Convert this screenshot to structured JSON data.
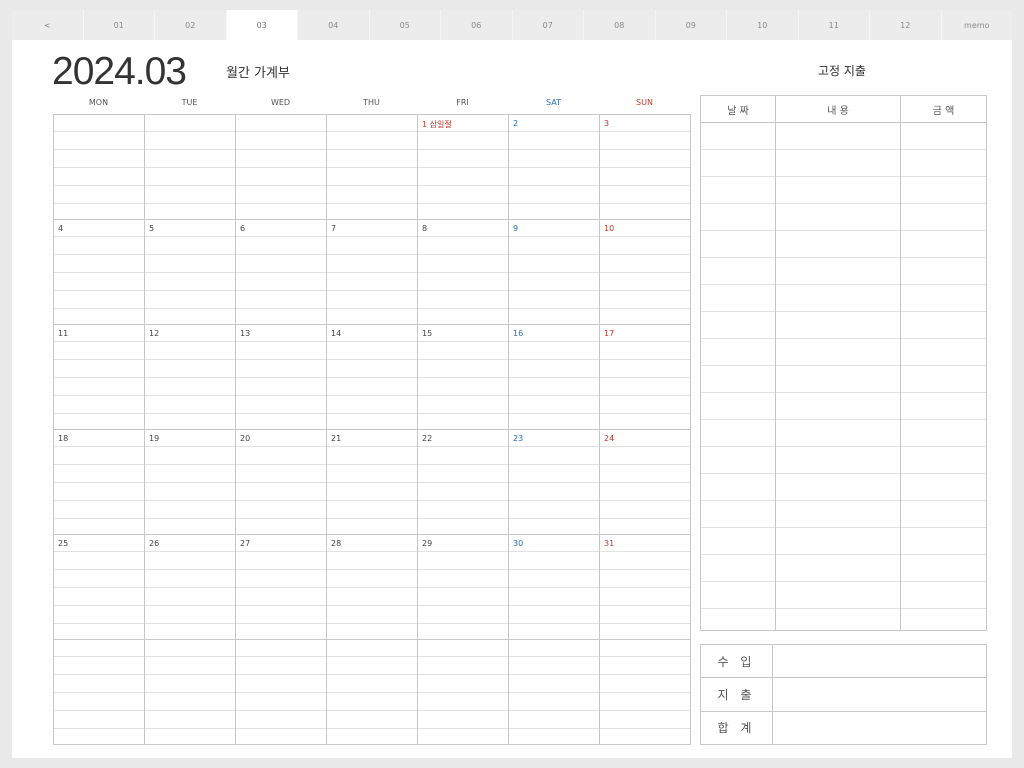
{
  "tabs": [
    {
      "label": "<"
    },
    {
      "label": "01"
    },
    {
      "label": "02"
    },
    {
      "label": "03"
    },
    {
      "label": "04"
    },
    {
      "label": "05"
    },
    {
      "label": "06"
    },
    {
      "label": "07"
    },
    {
      "label": "08"
    },
    {
      "label": "09"
    },
    {
      "label": "10"
    },
    {
      "label": "11"
    },
    {
      "label": "12"
    },
    {
      "label": "memo"
    }
  ],
  "active_tab": "03",
  "header": {
    "year_month": "2024.03",
    "subtitle": "월간 가계부"
  },
  "weekdays": [
    "MON",
    "TUE",
    "WED",
    "THU",
    "FRI",
    "SAT",
    "SUN"
  ],
  "calendar": {
    "weeks": [
      [
        "",
        "",
        "",
        "",
        "1 삼일절",
        "2",
        "3"
      ],
      [
        "4",
        "5",
        "6",
        "7",
        "8",
        "9",
        "10"
      ],
      [
        "11",
        "12",
        "13",
        "14",
        "15",
        "16",
        "17"
      ],
      [
        "18",
        "19",
        "20",
        "21",
        "22",
        "23",
        "24"
      ],
      [
        "25",
        "26",
        "27",
        "28",
        "29",
        "30",
        "31"
      ],
      [
        "",
        "",
        "",
        "",
        "",
        "",
        ""
      ]
    ],
    "holidays": [
      "1 삼일절"
    ]
  },
  "fixed_expense": {
    "title": "고정 지출",
    "headers": [
      "날 짜",
      "내 용",
      "금 액"
    ]
  },
  "summary": {
    "income": "수 입",
    "expense": "지 출",
    "total": "합 계"
  },
  "colors": {
    "saturday": "#2a6fb0",
    "sunday": "#c0392b",
    "grid": "#c8c8c8"
  }
}
